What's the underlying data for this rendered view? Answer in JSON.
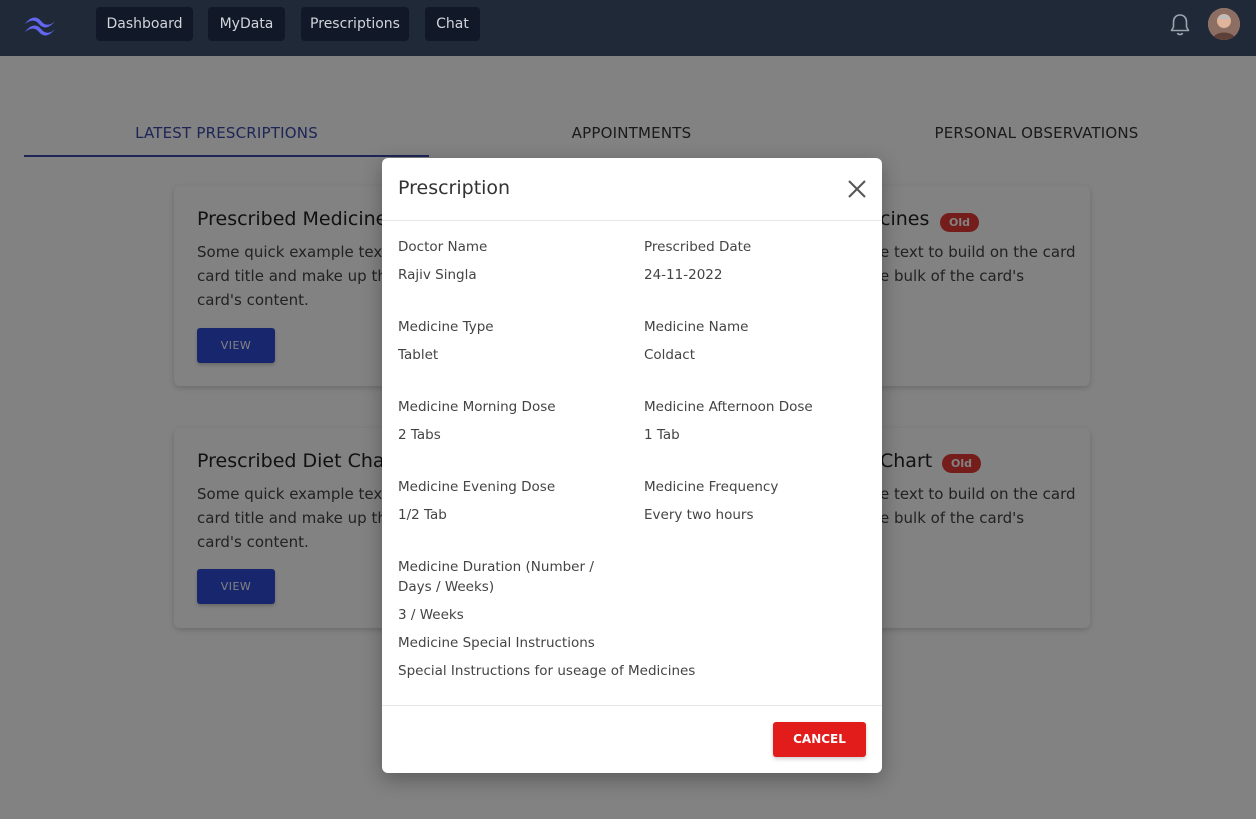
{
  "nav": {
    "items": [
      "Dashboard",
      "MyData",
      "Prescriptions",
      "Chat"
    ]
  },
  "tabs": [
    "LATEST PRESCRIPTIONS",
    "APPOINTMENTS",
    "PERSONAL OBSERVATIONS"
  ],
  "cards": {
    "medicine_title": "Prescribed Medicine",
    "medicine_right_title": "cines",
    "diet_title": "Prescribed Diet Cha",
    "diet_right_title": "Chart",
    "left_text": "Some quick example text to build on the card title and make up the bulk of the card's content.",
    "right_text_line1": "e text to build on the card",
    "right_text_line2": "e bulk of the card's",
    "view_label": "VIEW",
    "badge_label": "Old"
  },
  "modal": {
    "title": "Prescription",
    "fields": {
      "doctor_name_label": "Doctor Name",
      "doctor_name": "Rajiv Singla",
      "prescribed_date_label": "Prescribed Date",
      "prescribed_date": "24-11-2022",
      "medicine_type_label": "Medicine Type",
      "medicine_type": "Tablet",
      "medicine_name_label": "Medicine Name",
      "medicine_name": "Coldact",
      "morning_dose_label": "Medicine Morning Dose",
      "morning_dose": "2 Tabs",
      "afternoon_dose_label": "Medicine Afternoon Dose",
      "afternoon_dose": "1 Tab",
      "evening_dose_label": "Medicine Evening Dose",
      "evening_dose": "1/2 Tab",
      "frequency_label": "Medicine Frequency",
      "frequency": "Every two hours",
      "duration_label_line1": "Medicine Duration (Number /",
      "duration_label_line2": "Days / Weeks)",
      "duration": "3 / Weeks",
      "special_instructions_label": "Medicine Special Instructions",
      "special_instructions": "Special Instructions for useage of Medicines"
    },
    "cancel_label": "CANCEL"
  },
  "colors": {
    "navbar": "#1f2937",
    "accent": "#3949ab",
    "view_button": "#2f4bd6",
    "cancel_button": "#e21b1b",
    "badge": "#e53935"
  },
  "icons": [
    "logo-icon",
    "bell-icon",
    "close-icon"
  ]
}
